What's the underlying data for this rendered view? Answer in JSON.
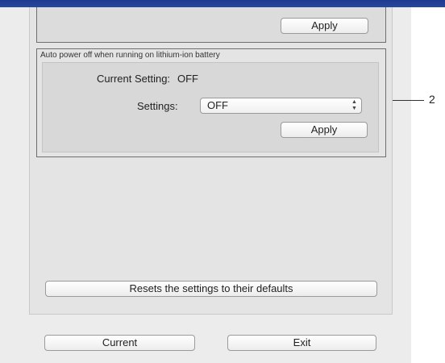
{
  "top_group": {
    "apply_label": "Apply"
  },
  "battery_group": {
    "title": "Auto power off when running on lithium-ion battery",
    "current_setting_label": "Current Setting:",
    "current_setting_value": "OFF",
    "settings_label": "Settings:",
    "settings_selected": "OFF",
    "select_arrows": "▲▼",
    "apply_label": "Apply"
  },
  "reset_button_label": "Resets the settings to their defaults",
  "bottom_buttons": {
    "current_label": "Current",
    "exit_label": "Exit"
  },
  "callout_number": "2"
}
